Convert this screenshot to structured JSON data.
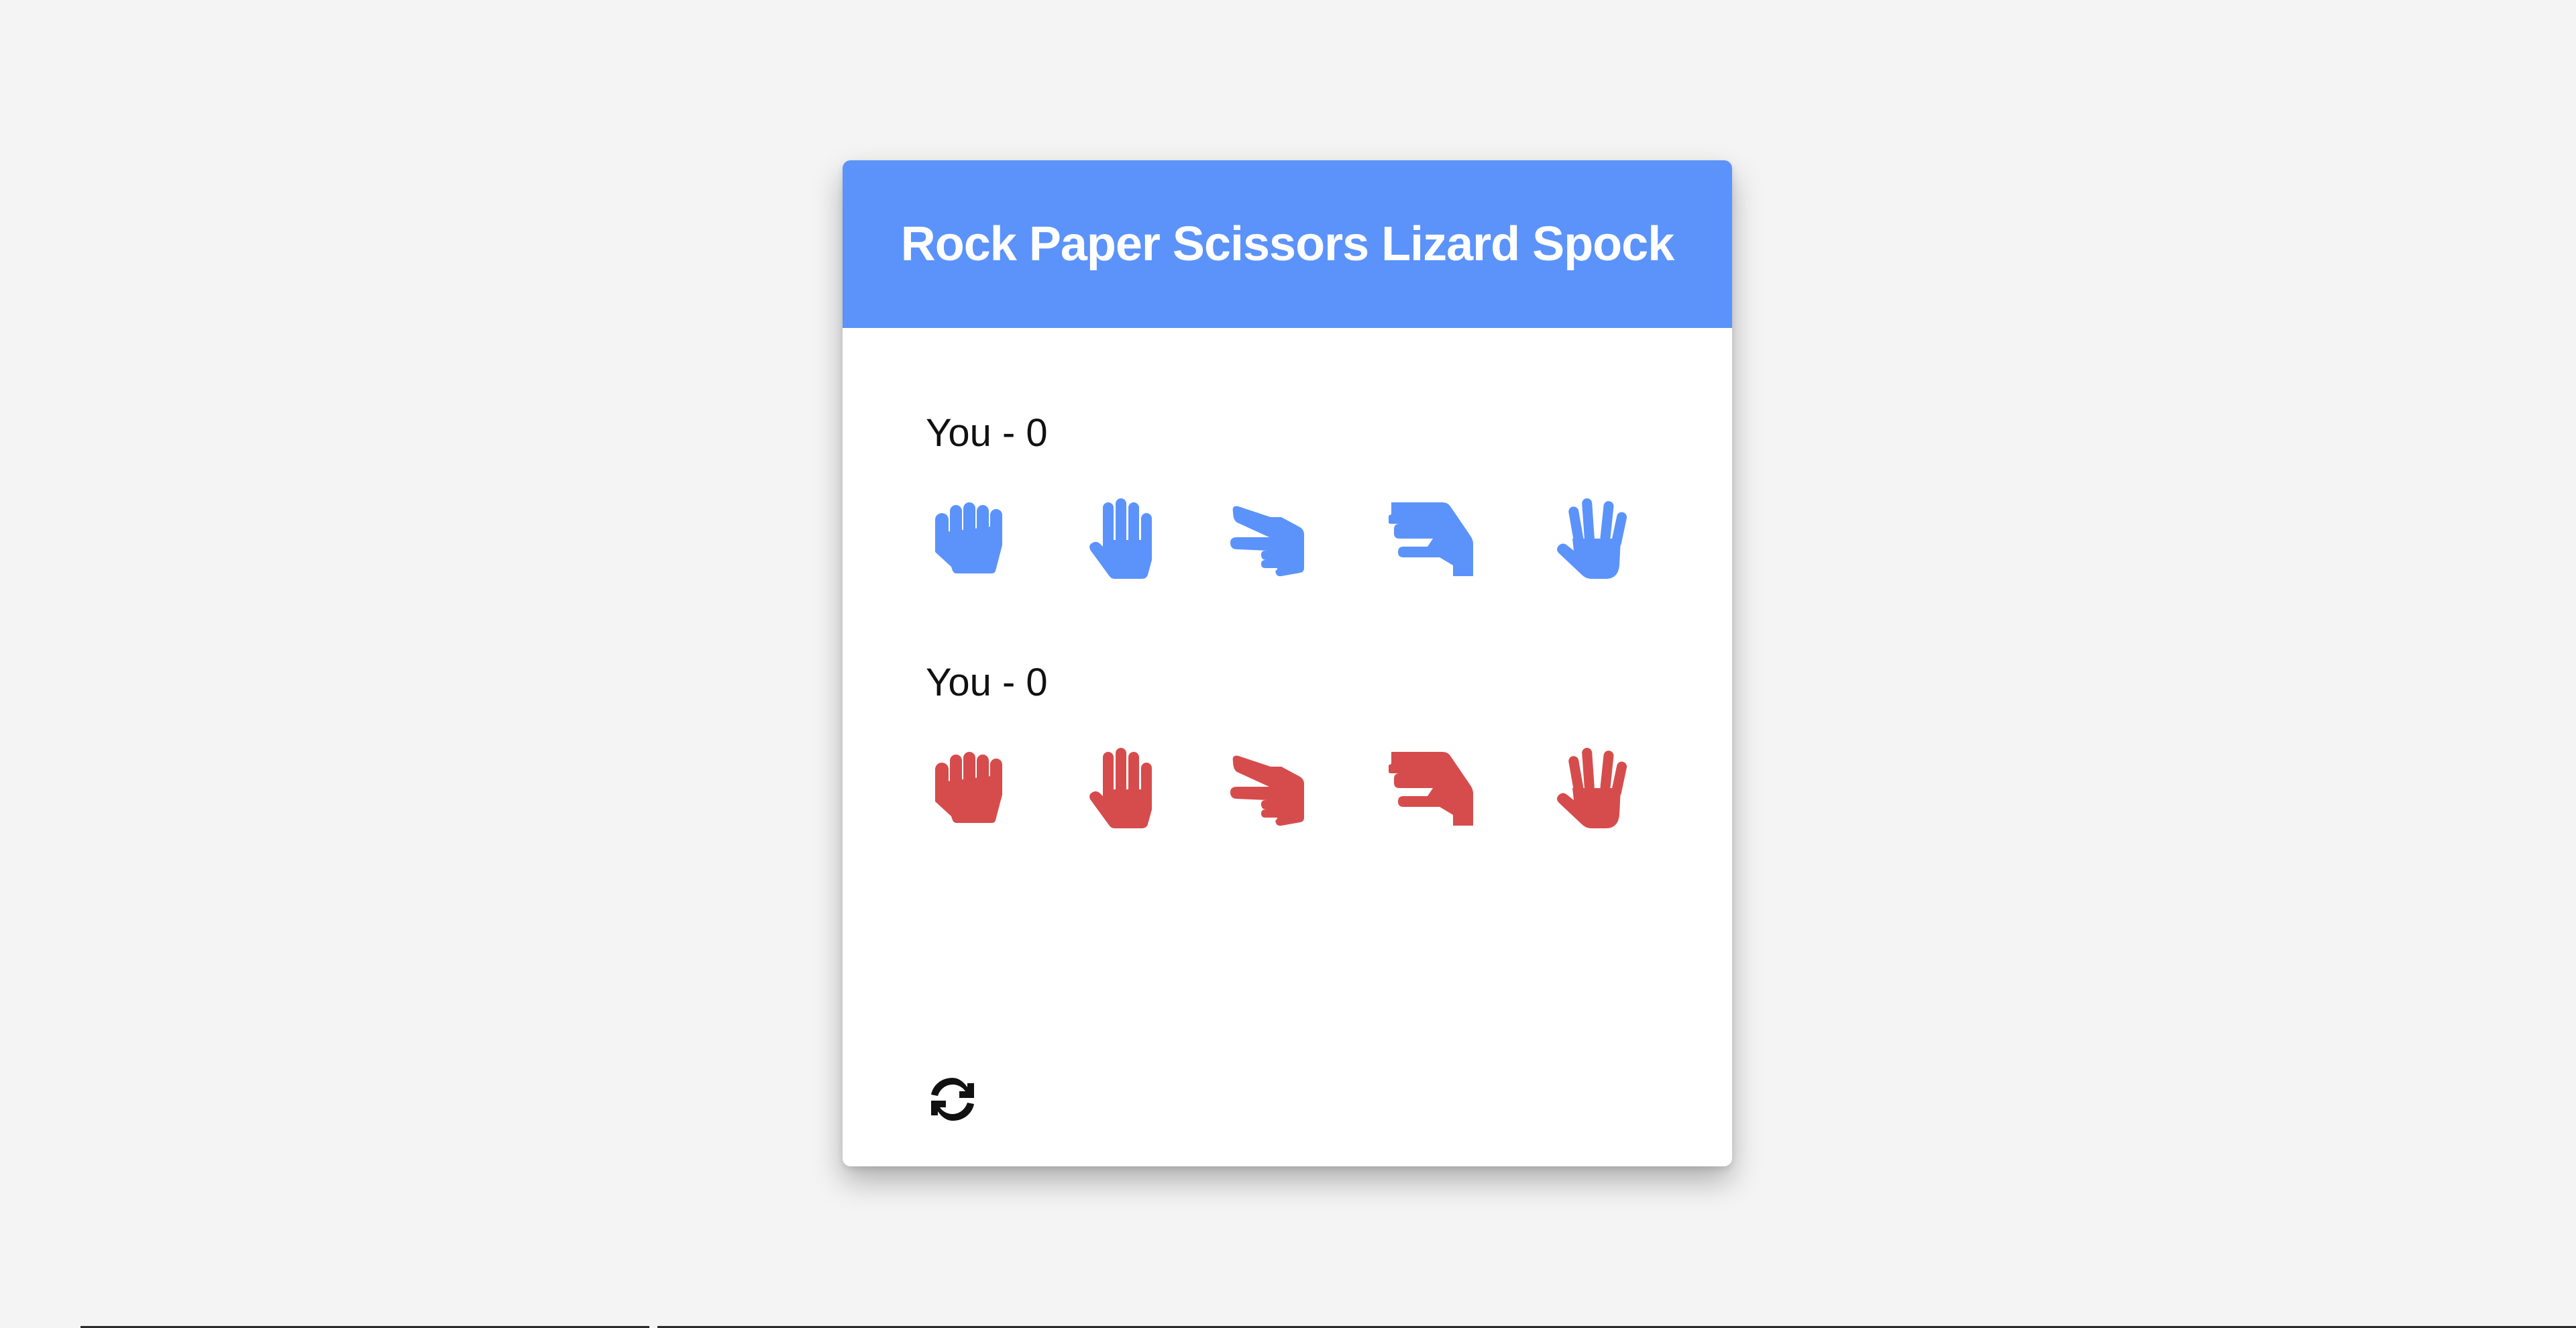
{
  "app": {
    "title": "Rock Paper Scissors Lizard Spock"
  },
  "colors": {
    "header": "#5b93fa",
    "player_one_hands": "#5b93fa",
    "player_two_hands": "#d64c4c",
    "background": "#f4f4f4"
  },
  "players": [
    {
      "label": "You - 0",
      "hands": [
        "rock-icon",
        "paper-icon",
        "scissors-icon",
        "lizard-icon",
        "spock-icon"
      ]
    },
    {
      "label": "You - 0",
      "hands": [
        "rock-icon",
        "paper-icon",
        "scissors-icon",
        "lizard-icon",
        "spock-icon"
      ]
    }
  ],
  "controls": {
    "reset_icon": "refresh-icon"
  }
}
